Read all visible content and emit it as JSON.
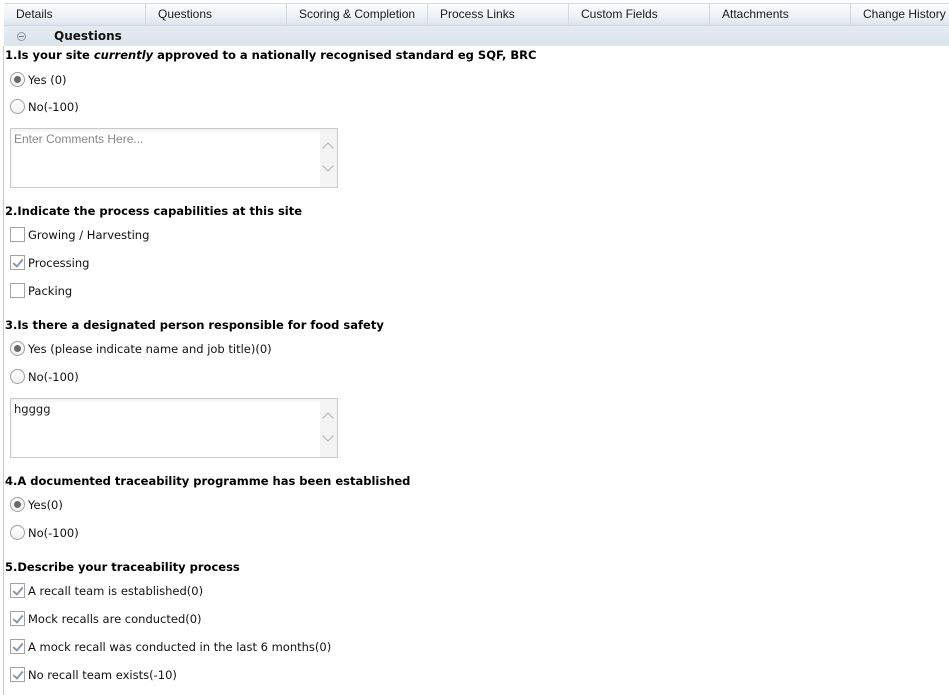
{
  "tabs": [
    {
      "label": "Details"
    },
    {
      "label": "Questions"
    },
    {
      "label": "Scoring & Completion"
    },
    {
      "label": "Process Links"
    },
    {
      "label": "Custom Fields"
    },
    {
      "label": "Attachments"
    },
    {
      "label": "Change History"
    }
  ],
  "section": {
    "title": "Questions",
    "collapse_icon": "collapse-minus-icon"
  },
  "questions": [
    {
      "title_pre": "1.Is your site ",
      "title_em": "currently",
      "title_post": " approved to a nationally recognised standard eg SQF, BRC",
      "type": "radio",
      "options": [
        {
          "label": "Yes (0)",
          "checked": true
        },
        {
          "label": "No(-100)",
          "checked": false
        }
      ],
      "comment": {
        "value": "",
        "placeholder": "Enter Comments Here..."
      }
    },
    {
      "title": "2.Indicate the process capabilities at this site",
      "type": "checkbox",
      "options": [
        {
          "label": "Growing / Harvesting",
          "checked": false
        },
        {
          "label": "Processing",
          "checked": true
        },
        {
          "label": "Packing",
          "checked": false
        }
      ]
    },
    {
      "title": "3.Is there a designated person responsible for food safety",
      "type": "radio",
      "options": [
        {
          "label": "Yes (please indicate name and job title)(0)",
          "checked": true
        },
        {
          "label": "No(-100)",
          "checked": false
        }
      ],
      "comment": {
        "value": "hgggg",
        "placeholder": "Enter Comments Here..."
      }
    },
    {
      "title": "4.A documented traceability programme has been established",
      "type": "radio",
      "options": [
        {
          "label": "Yes(0)",
          "checked": true
        },
        {
          "label": "No(-100)",
          "checked": false
        }
      ]
    },
    {
      "title": "5.Describe your traceability process",
      "type": "checkbox",
      "options": [
        {
          "label": "A recall team is established(0)",
          "checked": true
        },
        {
          "label": "Mock recalls are conducted(0)",
          "checked": true
        },
        {
          "label": "A mock recall was conducted in the last 6 months(0)",
          "checked": true
        },
        {
          "label": "No recall team exists(-10)",
          "checked": true
        }
      ]
    }
  ]
}
